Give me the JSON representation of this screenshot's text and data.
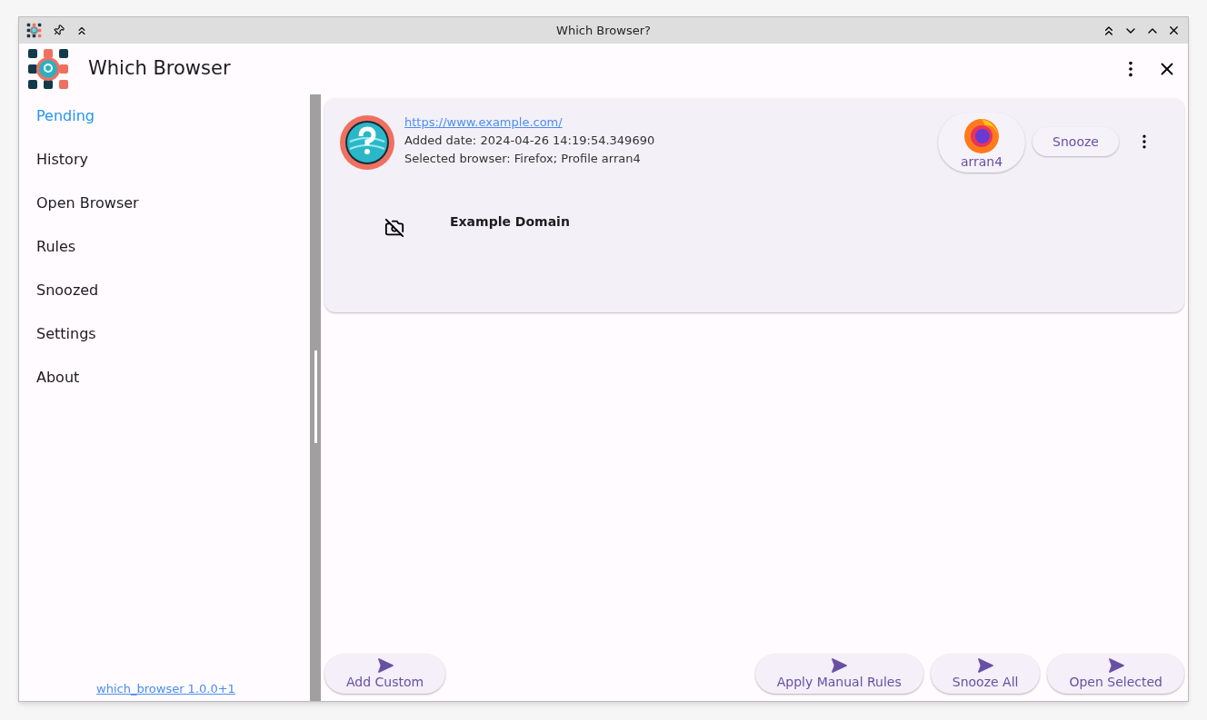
{
  "window": {
    "title": "Which Browser?"
  },
  "app_bar": {
    "title": "Which Browser"
  },
  "sidebar": {
    "items": [
      {
        "label": "Pending",
        "selected": true
      },
      {
        "label": "History",
        "selected": false
      },
      {
        "label": "Open Browser",
        "selected": false
      },
      {
        "label": "Rules",
        "selected": false
      },
      {
        "label": "Snoozed",
        "selected": false
      },
      {
        "label": "Settings",
        "selected": false
      },
      {
        "label": "About",
        "selected": false
      }
    ],
    "version": "which_browser 1.0.0+1"
  },
  "pending": [
    {
      "url": "https://www.example.com/",
      "added": "Added date: 2024-04-26 14:19:54.349690",
      "browser": "Selected browser: Firefox; Profile arran4",
      "profile": "arran4",
      "snooze": "Snooze",
      "page_title": "Example Domain"
    }
  ],
  "actions_left": [
    "Add Custom"
  ],
  "actions_right": [
    "Apply Manual Rules",
    "Snooze All",
    "Open Selected"
  ]
}
